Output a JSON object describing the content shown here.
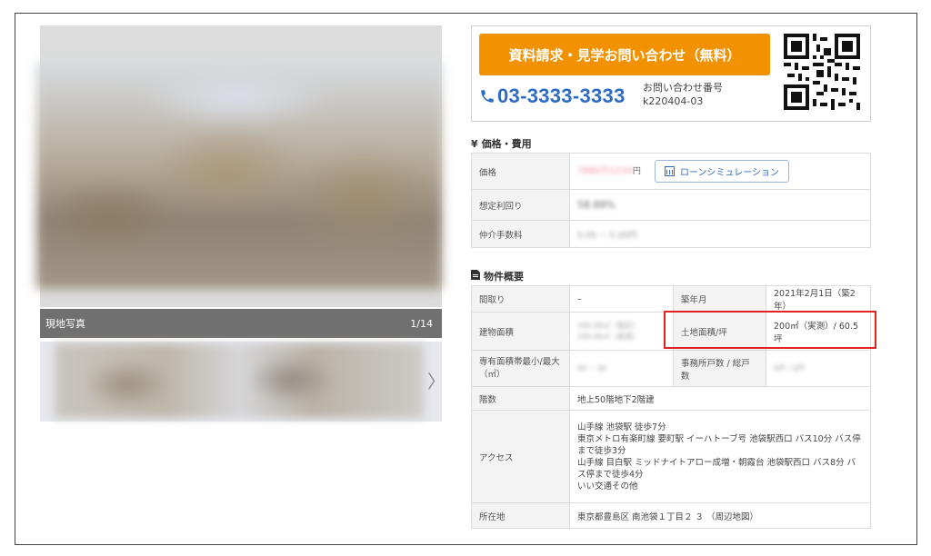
{
  "gallery": {
    "caption": "現地写真",
    "counter": "1/14",
    "next_arrow": "〉"
  },
  "contact": {
    "cta_label": "資料請求・見学お問い合わせ（無料）",
    "phone": "03-3333-3333",
    "inquiry_label": "お問い合わせ番号",
    "inquiry_number": "k220404-03"
  },
  "price_section": {
    "icon": "¥",
    "title": "価格・費用",
    "rows": [
      {
        "label": "価格",
        "value": "7880万1234",
        "unit": "円"
      },
      {
        "label": "想定利回り",
        "value": "58.88%"
      },
      {
        "label": "仲介手数料",
        "value": "0.00 ~ 0.00円"
      }
    ],
    "loan_button": "ローンシミュレーション"
  },
  "spec_section": {
    "title": "物件概要",
    "rows": [
      {
        "l1": "間取り",
        "v1": "–",
        "l2": "築年月",
        "v2": "2021年2月1日（築2年）"
      },
      {
        "l1": "建物面積",
        "v1": [
          "200.00㎡（登記）",
          "200.00㎡（実測）"
        ],
        "l2": "土地面積/坪",
        "v2": "200㎡（実測）/ 60.5坪"
      },
      {
        "l1": "専有面積帯最小/最大（㎡）",
        "v1": "00 ~ 00",
        "l2": "事務所戸数 / 総戸数",
        "v2": "0戸 / 0戸"
      }
    ],
    "floors_label": "階数",
    "floors_value": "地上50階地下2階建",
    "access_label": "アクセス",
    "access_lines": [
      "山手線 池袋駅 徒歩7分",
      "東京メトロ有楽町線 要町駅 イーハトーブ号 池袋駅西口 バス10分 バス停まで徒歩3分",
      "山手線 目白駅 ミッドナイトアロー成増・朝霞台 池袋駅西口 バス8分 バス停まで徒歩4分",
      "いい交通その他"
    ],
    "address_label": "所在地",
    "address_value": "東京都豊島区 南池袋１丁目２ ３ （周辺地図）"
  },
  "colors": {
    "cta": "#f39200",
    "phone": "#2e6bc4",
    "highlight": "#e32222"
  }
}
